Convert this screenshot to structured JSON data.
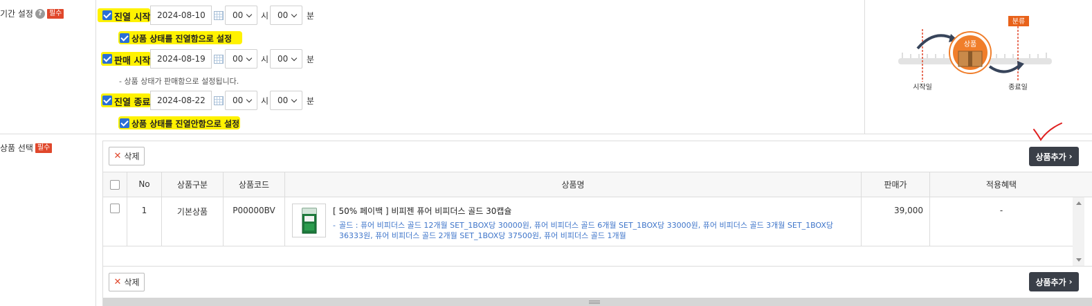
{
  "period": {
    "label": "기간 설정",
    "required_badge": "필수",
    "display_start": {
      "label": "진열 시작",
      "date": "2024-08-10",
      "hour": "00",
      "hour_unit": "시",
      "minute": "00",
      "minute_unit": "분",
      "sub_option": "상품 상태를 진열함으로 설정"
    },
    "sale_start": {
      "label": "판매 시작",
      "date": "2024-08-19",
      "hour": "00",
      "hour_unit": "시",
      "minute": "00",
      "minute_unit": "분",
      "note": "- 상품 상태가 판매함으로 설정됩니다."
    },
    "display_end": {
      "label": "진열 종료",
      "date": "2024-08-22",
      "hour": "00",
      "hour_unit": "시",
      "minute": "00",
      "minute_unit": "분",
      "sub_option": "상품 상태를 진열안함으로 설정"
    }
  },
  "diagram": {
    "badge": "분류",
    "product": "상품",
    "start": "시작일",
    "end": "종료일"
  },
  "product_select": {
    "label": "상품 선택",
    "required_badge": "필수",
    "delete_label": "삭제",
    "add_label": "상품추가",
    "columns": [
      "No",
      "상품구분",
      "상품코드",
      "상품명",
      "판매가",
      "적용혜택"
    ],
    "rows": [
      {
        "no": "1",
        "type": "기본상품",
        "code": "P00000BV",
        "name": "[ 50% 페이백 ] 비피젠 퓨어 비피더스 골드 30캡슐",
        "desc": "골드 : 퓨어 비피더스 골드 12개월 SET_1BOX당 30000원, 퓨어 비피더스 골드 6개월 SET_1BOX당 33000원, 퓨어 비피더스 골드 3개월 SET_1BOX당 36333원, 퓨어 비피더스 골드 2개월 SET_1BOX당 37500원, 퓨어 비피더스 골드 1개월",
        "price": "39,000",
        "benefit": "-"
      }
    ]
  },
  "colors": {
    "highlight": "#fff200",
    "checkbox": "#2a6fd6",
    "badge": "#e0472b",
    "dark_button": "#3a3f48",
    "link_blue": "#3d74c9",
    "diagram_orange": "#f07e2b"
  }
}
